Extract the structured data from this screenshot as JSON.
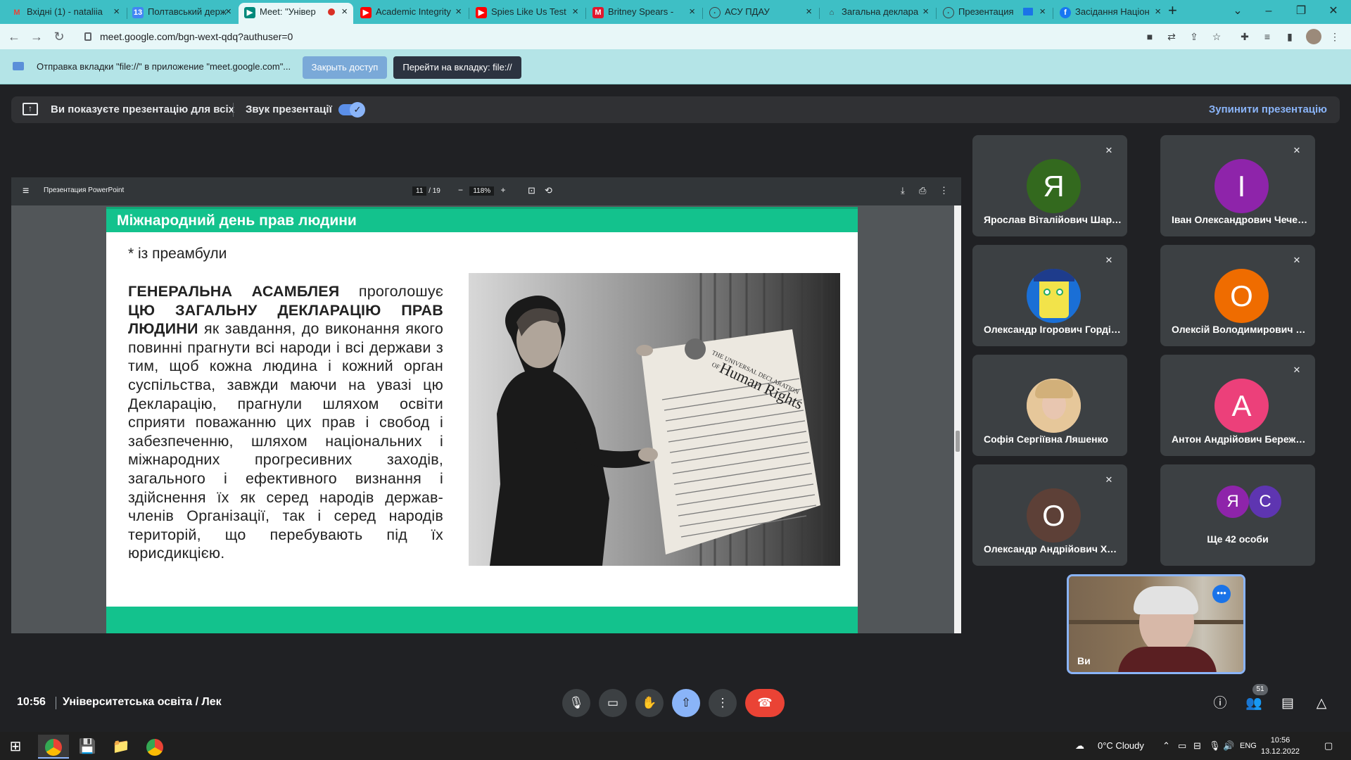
{
  "browser": {
    "tabs": [
      {
        "label": "Вхідні (1) - nataliia",
        "icon": "gmail-icon",
        "icon_color": "#ea4335"
      },
      {
        "label": "Полтавський держ",
        "icon": "calendar-icon",
        "icon_color": "#4285f4"
      },
      {
        "label": "Meet: \"Універ",
        "icon": "meet-icon",
        "icon_color": "#00897b"
      },
      {
        "label": "Academic Integrity",
        "icon": "youtube-icon",
        "icon_color": "#ff0000"
      },
      {
        "label": "Spies Like Us Test",
        "icon": "youtube-icon",
        "icon_color": "#ff0000"
      },
      {
        "label": "Britney Spears - ",
        "icon": "musixmatch-icon",
        "icon_color": "#e3172d"
      },
      {
        "label": "АСУ ПДАУ",
        "icon": "globe-icon",
        "icon_color": "#5f6368"
      },
      {
        "label": "Загальна деклара",
        "icon": "institution-icon",
        "icon_color": "#5f6368"
      },
      {
        "label": "Презентация",
        "icon": "globe-icon",
        "icon_color": "#5f6368"
      },
      {
        "label": "Засідання Націон",
        "icon": "facebook-icon",
        "icon_color": "#1877f2"
      }
    ],
    "url": "meet.google.com/bgn-wext-qdq?authuser=0"
  },
  "infobar": {
    "message": "Отправка вкладки \"file://\" в приложение \"meet.google.com\"...",
    "close_access_label": "Закрыть доступ",
    "goto_tab_label": "Перейти на вкладку: file://"
  },
  "presenting_bar": {
    "status": "Ви показуєте презентацію для всіх",
    "sound_label": "Звук презентації",
    "stop_label": "Зупинити презентацію"
  },
  "pdf_viewer": {
    "title": "Презентация PowerPoint",
    "current_page": "11",
    "total_pages": "/ 19",
    "zoom": "118%"
  },
  "slide": {
    "heading": "Міжнародний день прав людини",
    "preamble": "* із преамбули",
    "bold_1": "ГЕНЕРАЛЬНА АСАМБЛЕЯ",
    "text_1": " проголошує ",
    "bold_2": "ЦЮ ЗАГАЛЬНУ ДЕКЛАРАЦІЮ ПРАВ ЛЮДИНИ",
    "text_2": " як завдання, до виконання якого повинні прагнути всі народи і всі держави з тим, щоб кожна людина і кожний орган суспільства, завжди маючи на увазі цю Декларацію, прагнули шляхом освіти сприяти поважанню цих прав і свобод і забезпеченню, шляхом національних і міжнародних прогресивних заходів, загального і ефективного визнання і здійснення їх як серед народів держав-членів Організації, так і серед народів територій, що перебувають під їх юрисдикцією.",
    "poster_line_1": "THE UNIVERSAL DECLARATION",
    "poster_line_2": "OF",
    "poster_line_3": "Human Rights"
  },
  "participants": [
    {
      "initial": "Я",
      "name": "Ярослав Віталійович Шарлай",
      "color": "#33691e"
    },
    {
      "initial": "І",
      "name": "Іван Олександрович Чечель",
      "color": "#8e24aa"
    },
    {
      "initial": "",
      "name": "Олександр Ігорович Гордівськ...",
      "color": "#1a6fd6"
    },
    {
      "initial": "О",
      "name": "Олексій Володимирович Вільх...",
      "color": "#ef6c00"
    },
    {
      "initial": "",
      "name": "Софія Сергіївна Ляшенко",
      "color": "#c9a27e"
    },
    {
      "initial": "А",
      "name": "Антон Андрійович Бережний",
      "color": "#ec407a"
    },
    {
      "initial": "О",
      "name": "Олександр Андрійович Халепа",
      "color": "#5d4037"
    }
  ],
  "others": {
    "initials": [
      "Я",
      "С"
    ],
    "colors": [
      "#8e24aa",
      "#5e35b1"
    ],
    "label": "Ще 42 особи"
  },
  "self_view": {
    "label": "Ви"
  },
  "bottom": {
    "time": "10:56",
    "meeting_name": "Університетська освіта / Лек",
    "people_count": "51"
  },
  "taskbar": {
    "weather": "0°C  Cloudy",
    "language": "ENG",
    "time": "10:56",
    "date": "13.12.2022"
  }
}
